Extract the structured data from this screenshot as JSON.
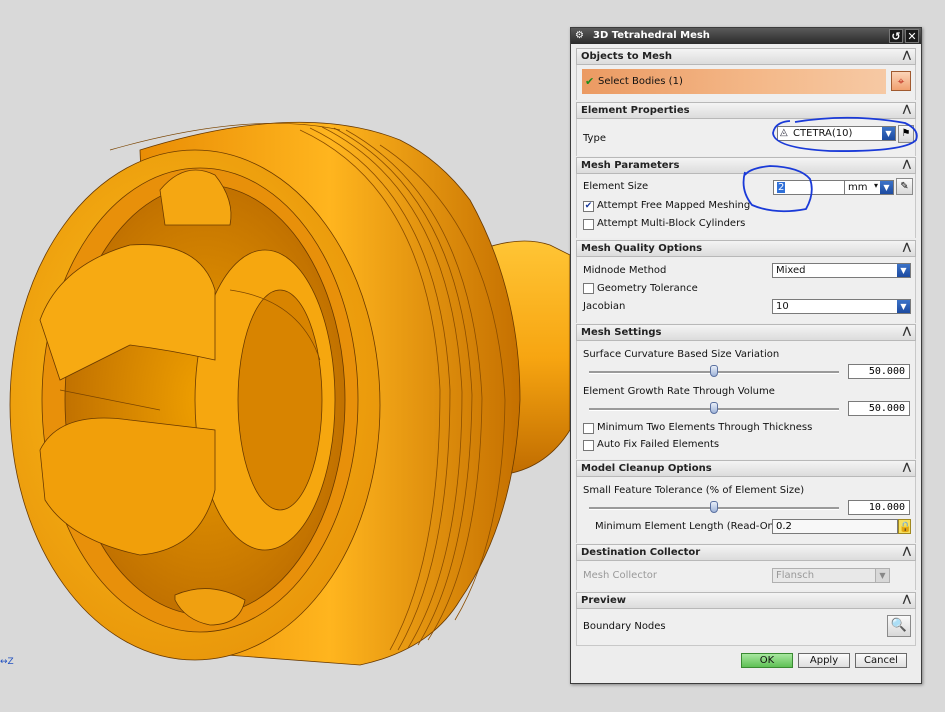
{
  "viewport": {
    "axis_label": "Z"
  },
  "dialog": {
    "title": "3D Tetrahedral Mesh",
    "titlebar": {
      "gear_icon": "gear-icon",
      "reset_icon": "↺",
      "close_icon": "✕"
    },
    "objects": {
      "header": "Objects to Mesh",
      "select_label": "Select Bodies (1)"
    },
    "element_props": {
      "header": "Element Properties",
      "type_label": "Type",
      "type_value": "CTETRA(10)"
    },
    "mesh_params": {
      "header": "Mesh Parameters",
      "size_label": "Element Size",
      "size_value": "2",
      "unit": "mm",
      "attempt_free_mapped": "Attempt Free Mapped Meshing",
      "attempt_free_mapped_checked": true,
      "attempt_multiblock": "Attempt Multi-Block Cylinders",
      "attempt_multiblock_checked": false
    },
    "quality": {
      "header": "Mesh Quality Options",
      "midnode_label": "Midnode Method",
      "midnode_value": "Mixed",
      "geom_tol": "Geometry Tolerance",
      "jacobian_label": "Jacobian",
      "jacobian_value": "10"
    },
    "settings": {
      "header": "Mesh Settings",
      "curvature_label": "Surface Curvature Based Size Variation",
      "curvature_value": "50.000",
      "curvature_fraction": 0.5,
      "growth_label": "Element Growth Rate Through Volume",
      "growth_value": "50.000",
      "growth_fraction": 0.5,
      "min_two": "Minimum Two Elements Through Thickness",
      "auto_fix": "Auto Fix Failed Elements"
    },
    "cleanup": {
      "header": "Model Cleanup Options",
      "small_feature_label": "Small Feature Tolerance (% of Element Size)",
      "small_feature_value": "10.000",
      "small_feature_fraction": 0.5,
      "min_length_label": "Minimum Element Length (Read-Only)",
      "min_length_value": "0.2"
    },
    "destination": {
      "header": "Destination Collector",
      "collector_label": "Mesh Collector",
      "collector_value": "Flansch"
    },
    "preview": {
      "header": "Preview",
      "boundary_label": "Boundary Nodes"
    },
    "buttons": {
      "ok": "OK",
      "apply": "Apply",
      "cancel": "Cancel"
    },
    "colors": {
      "highlight_bar": "#eea06a",
      "accent": "#1c4aa0",
      "annotation": "#1a3ad8"
    }
  }
}
